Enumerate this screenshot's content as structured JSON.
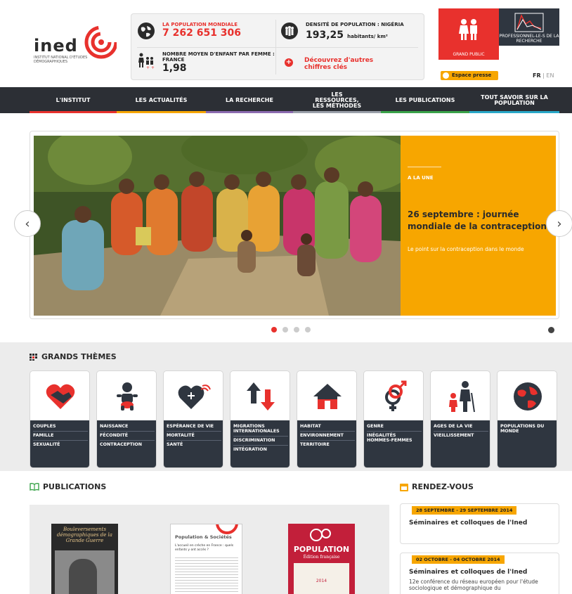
{
  "header": {
    "logo_word": "ined",
    "logo_subtitle": "INSTITUT NATIONAL D'ÉTUDES DÉMOGRAPHIQUES",
    "stats": {
      "world_label": "LA POPULATION MONDIALE",
      "world_value": "7 262 651 306",
      "density_label": "DENSITÉ DE POPULATION : NIGÉRIA",
      "density_value": "193,25",
      "density_unit": "habitants/ km²",
      "children_label": "NOMBRE MOYEN D'ENFANT PAR FEMME : FRANCE",
      "children_value": "1,98",
      "discover_label": "Découvrez d'autres chiffres clés"
    },
    "grand_public": "GRAND PUBLIC",
    "professionnel": "PROFESSIONNEL-LE-S DE LA RECHERCHE",
    "espace_presse": "Espace presse",
    "lang_fr": "FR",
    "lang_sep": "|",
    "lang_en": "EN"
  },
  "nav": [
    {
      "label": "L'INSTITUT",
      "color": "#e8312d"
    },
    {
      "label": "LES ACTUALITÉS",
      "color": "#f7a600"
    },
    {
      "label": "LA RECHERCHE",
      "color": "#8c6bb1"
    },
    {
      "label": "LES RESSOURCES, LES MÉTHODES",
      "color": "#9aa0aa"
    },
    {
      "label": "LES PUBLICATIONS",
      "color": "#3aa34a"
    },
    {
      "label": "TOUT SAVOIR SUR LA POPULATION",
      "color": "#29a8c9"
    }
  ],
  "slide": {
    "tag": "A LA UNE",
    "title": "26 septembre : journée mondiale de la contraception",
    "desc": "Le point sur la contraception dans le monde",
    "prev": "‹",
    "next": "›",
    "dot_count": 4,
    "active_dot": 1
  },
  "themes": {
    "title": "GRANDS THÈMES",
    "cards": [
      {
        "icon": "handshake-heart-icon",
        "links": [
          "COUPLES",
          "FAMILLE",
          "SEXUALITÉ"
        ]
      },
      {
        "icon": "baby-icon",
        "links": [
          "NAISSANCE",
          "FÉCONDITÉ",
          "CONTRACEPTION"
        ]
      },
      {
        "icon": "heart-pulse-icon",
        "links": [
          "ESPÉRANCE DE VIE",
          "MORTALITÉ",
          "SANTÉ"
        ]
      },
      {
        "icon": "migration-arrows-icon",
        "links": [
          "MIGRATIONS INTERNATIONALES",
          "DISCRIMINATION",
          "INTÉGRATION"
        ]
      },
      {
        "icon": "house-icon",
        "links": [
          "HABITAT",
          "ENVIRONNEMENT",
          "TERRITOIRE"
        ]
      },
      {
        "icon": "gender-symbols-icon",
        "links": [
          "GENRE",
          "INÉGALITÉS HOMMES-FEMMES"
        ]
      },
      {
        "icon": "elderly-child-icon",
        "links": [
          "AGES DE LA VIE",
          "VIEILLISSEMENT"
        ]
      },
      {
        "icon": "globe-icon",
        "links": [
          "POPULATIONS DU MONDE"
        ]
      }
    ]
  },
  "publications": {
    "title": "PUBLICATIONS",
    "book1_title": "Bouleversements démographiques de la Grande Guerre",
    "book2_title": "Population & Sociétés",
    "book2_sub": "L'accueil en crèche en France : quels enfants y ont accès ?",
    "book3_title": "POPULATION",
    "book3_sub": "Édition française",
    "book3_year": "2014"
  },
  "rendezvous": {
    "title": "RENDEZ-VOUS",
    "events": [
      {
        "date": "28 SEPTEMBRE - 29 SEPTEMBRE 2014",
        "title": "Séminaires et colloques de l'Ined",
        "desc": ""
      },
      {
        "date": "02 OCTOBRE - 04 OCTOBRE 2014",
        "title": "Séminaires et colloques de l'Ined",
        "desc": "12e conférence du réseau européen pour l'étude sociologique et démographique du"
      }
    ]
  },
  "colors": {
    "red": "#e8312d",
    "orange": "#f7a600",
    "dark": "#2f3640",
    "navbar": "#2c2f35"
  }
}
